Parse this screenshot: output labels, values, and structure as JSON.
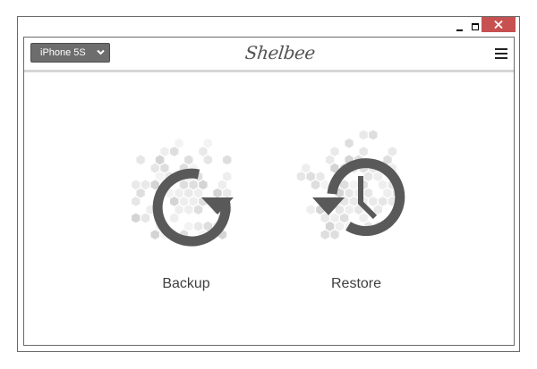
{
  "window": {
    "controls": {
      "minimize": "minimize",
      "maximize": "maximize",
      "close": "close"
    },
    "close_color": "#c75050"
  },
  "header": {
    "device_select": {
      "value": "iPhone 5S"
    },
    "logo": "Shelbee",
    "menu_icon": "hamburger-menu-icon"
  },
  "actions": [
    {
      "label": "Backup",
      "icon": "backup-refresh-icon"
    },
    {
      "label": "Restore",
      "icon": "restore-clock-icon"
    }
  ],
  "colors": {
    "icon": "#595959",
    "hex_pattern": "#e2e2e2",
    "select_bg": "#6d6d6d"
  }
}
